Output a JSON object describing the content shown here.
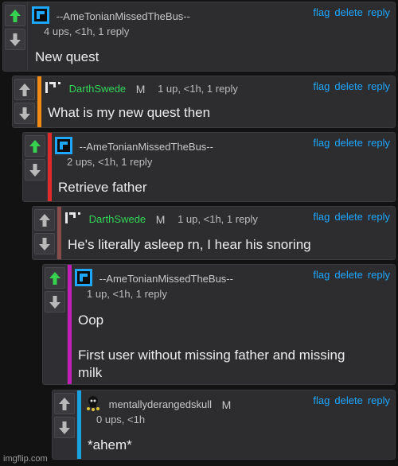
{
  "actions": {
    "flag": "flag",
    "delete": "delete",
    "reply": "reply"
  },
  "colors": {
    "upvoted_arrow": "#35d14f",
    "neutral_arrow": "#b9b9b9",
    "link": "#1ea7ff"
  },
  "comments": [
    {
      "username": "--AmeTonianMissedTheBus--",
      "avatar_icon": "blue-square-avatar-icon",
      "stats": "4 ups, <1h, 1 reply",
      "text": "New quest",
      "upvoted": true,
      "bar_color": ""
    },
    {
      "username": "DarthSwede",
      "mod_badge": "M",
      "avatar_icon": "pixel-avatar-icon",
      "stats": "1 up, <1h, 1 reply",
      "text": "What is my new quest then",
      "upvoted": false,
      "bar_color": "#f08a12"
    },
    {
      "username": "--AmeTonianMissedTheBus--",
      "avatar_icon": "blue-square-avatar-icon",
      "stats": "2 ups, <1h, 1 reply",
      "text": "Retrieve father",
      "upvoted": true,
      "bar_color": "#e02a2a"
    },
    {
      "username": "DarthSwede",
      "mod_badge": "M",
      "avatar_icon": "pixel-avatar-icon",
      "stats": "1 up, <1h, 1 reply",
      "text": "He's literally asleep rn, I hear his snoring",
      "upvoted": false,
      "bar_color": "#8a4b4b"
    },
    {
      "username": "--AmeTonianMissedTheBus--",
      "avatar_icon": "blue-square-avatar-icon",
      "stats": "1 up, <1h, 1 reply",
      "text_lines": [
        "Oop",
        "",
        "First user without missing father and missing",
        "milk"
      ],
      "upvoted": true,
      "bar_color": "#c21fb8"
    },
    {
      "username": "mentallyderangedskull",
      "mod_badge": "M",
      "avatar_icon": "skull-avatar-icon",
      "stats": "0 ups, <1h",
      "text": "*ahem*",
      "upvoted": false,
      "bar_color": "#1aa3e0"
    }
  ],
  "watermark": "imgflip.com"
}
